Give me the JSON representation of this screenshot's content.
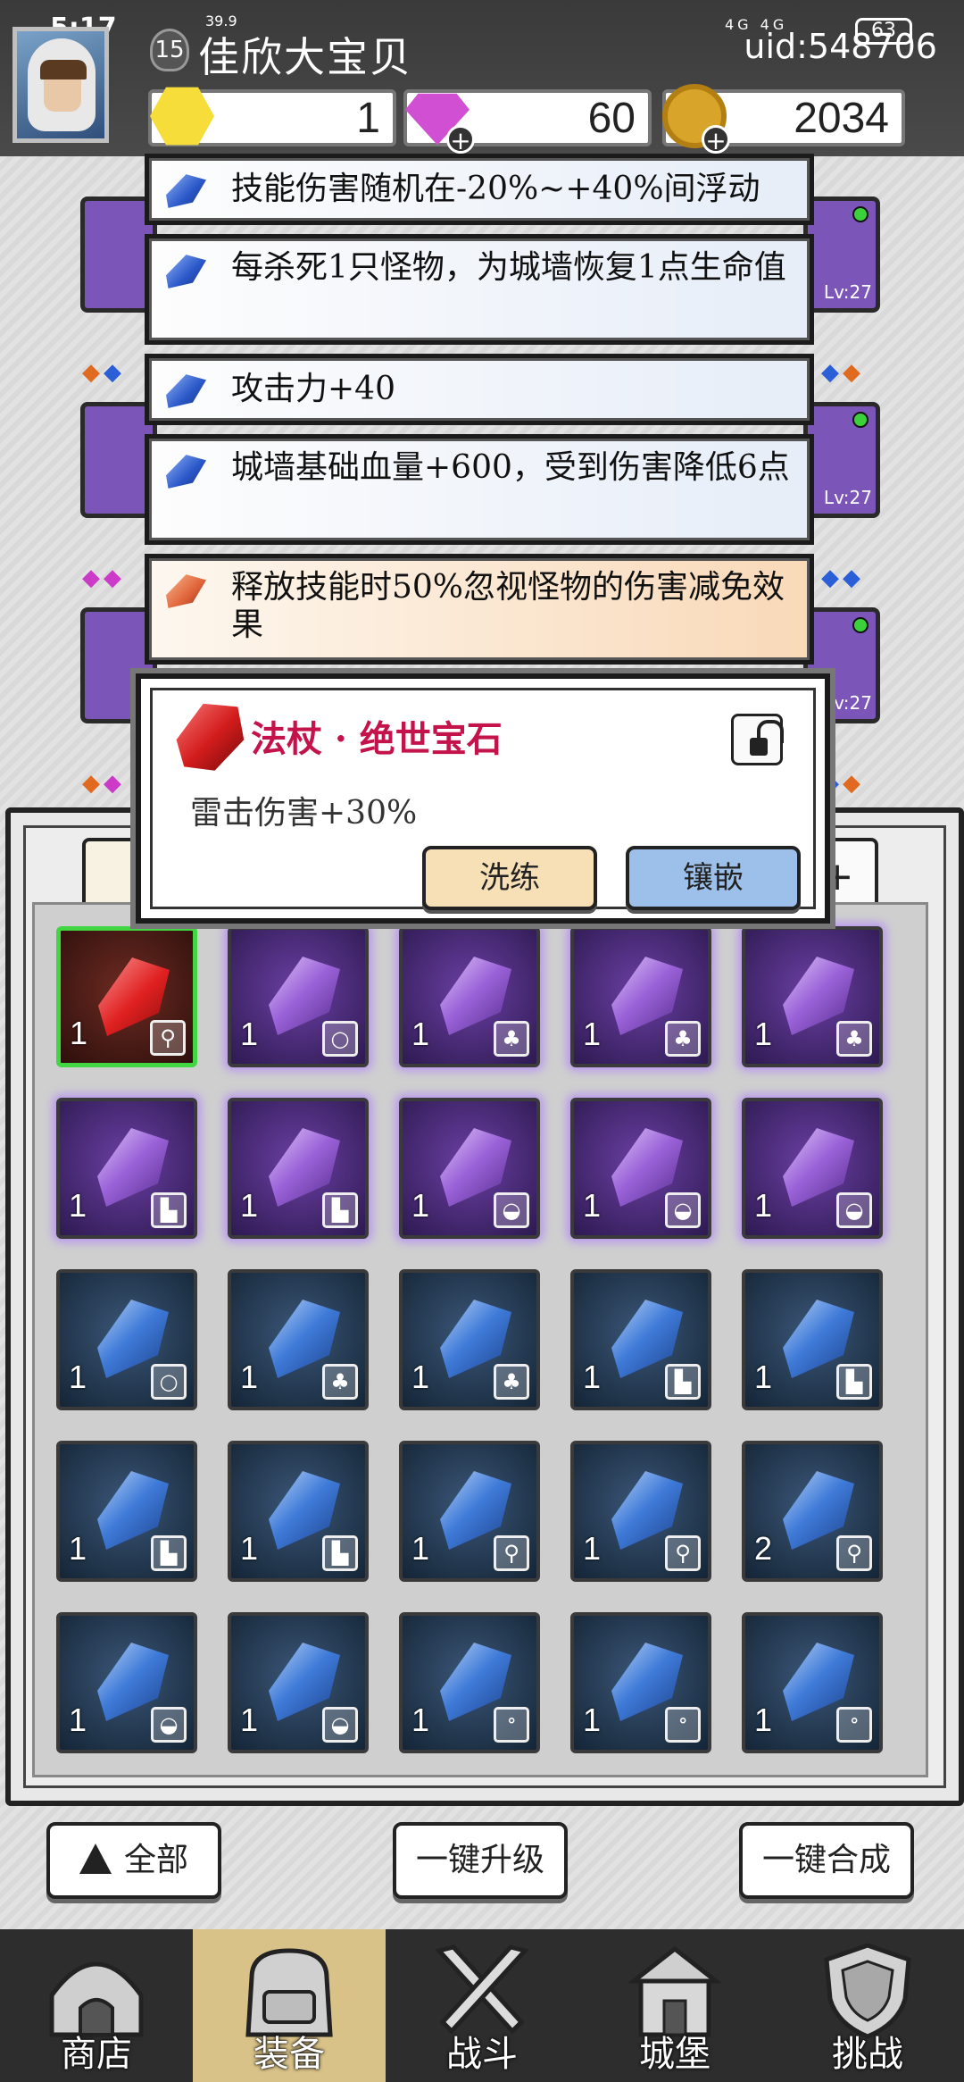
{
  "status_bar": {
    "time": "5:17",
    "net_speed": "39.9",
    "signal": "4G 4G",
    "battery": "63",
    "uid": "uid:548706"
  },
  "player": {
    "level": "15",
    "name": "佳欣大宝贝"
  },
  "resources": {
    "energy": "1",
    "diamonds": "60",
    "gold": "2034"
  },
  "tooltips": [
    {
      "text": "技能伤害随机在-20%~+40%间浮动",
      "color": "blue"
    },
    {
      "text": "每杀死1只怪物，为城墙恢复1点生命值",
      "color": "blue"
    },
    {
      "text": "攻击力+40",
      "color": "blue"
    },
    {
      "text": "城墙基础血量+600，受到伤害降低6点",
      "color": "blue"
    },
    {
      "text": "释放技能时50%忽视怪物的伤害减免效果",
      "color": "orange"
    }
  ],
  "equipment_level_label": "Lv:27",
  "gem_popup": {
    "title": "法杖 · 绝世宝石",
    "description": "雷击伤害+30%",
    "refine_label": "洗练",
    "inlay_label": "镶嵌"
  },
  "inventory": [
    {
      "rarity": "red",
      "count": "1",
      "slot": "staff"
    },
    {
      "rarity": "purple",
      "count": "1",
      "slot": "ring"
    },
    {
      "rarity": "purple",
      "count": "1",
      "slot": "armor"
    },
    {
      "rarity": "purple",
      "count": "1",
      "slot": "armor"
    },
    {
      "rarity": "purple",
      "count": "1",
      "slot": "armor"
    },
    {
      "rarity": "purple",
      "count": "1",
      "slot": "boots"
    },
    {
      "rarity": "purple",
      "count": "1",
      "slot": "boots"
    },
    {
      "rarity": "purple",
      "count": "1",
      "slot": "helmet"
    },
    {
      "rarity": "purple",
      "count": "1",
      "slot": "helmet"
    },
    {
      "rarity": "purple",
      "count": "1",
      "slot": "helmet"
    },
    {
      "rarity": "blue",
      "count": "1",
      "slot": "ring"
    },
    {
      "rarity": "blue",
      "count": "1",
      "slot": "armor"
    },
    {
      "rarity": "blue",
      "count": "1",
      "slot": "armor"
    },
    {
      "rarity": "blue",
      "count": "1",
      "slot": "boots"
    },
    {
      "rarity": "blue",
      "count": "1",
      "slot": "boots"
    },
    {
      "rarity": "blue",
      "count": "1",
      "slot": "boots"
    },
    {
      "rarity": "blue",
      "count": "1",
      "slot": "boots"
    },
    {
      "rarity": "blue",
      "count": "1",
      "slot": "staff"
    },
    {
      "rarity": "blue",
      "count": "1",
      "slot": "staff"
    },
    {
      "rarity": "blue",
      "count": "2",
      "slot": "staff"
    },
    {
      "rarity": "blue",
      "count": "1",
      "slot": "helmet"
    },
    {
      "rarity": "blue",
      "count": "1",
      "slot": "helmet"
    },
    {
      "rarity": "blue",
      "count": "1",
      "slot": "necklace"
    },
    {
      "rarity": "blue",
      "count": "1",
      "slot": "necklace"
    },
    {
      "rarity": "blue",
      "count": "1",
      "slot": "necklace"
    }
  ],
  "actions": {
    "filter_label": "全部",
    "upgrade_all_label": "一键升级",
    "merge_all_label": "一键合成"
  },
  "nav": [
    {
      "label": "商店",
      "icon": "shop-icon"
    },
    {
      "label": "装备",
      "icon": "backpack-icon",
      "active": true
    },
    {
      "label": "战斗",
      "icon": "crossed-swords-icon"
    },
    {
      "label": "城堡",
      "icon": "castle-icon"
    },
    {
      "label": "挑战",
      "icon": "shield-icon"
    }
  ],
  "colors": {
    "popup_title": "#c4124a",
    "selected_border": "#42d642",
    "nav_active": "#d9c288"
  }
}
